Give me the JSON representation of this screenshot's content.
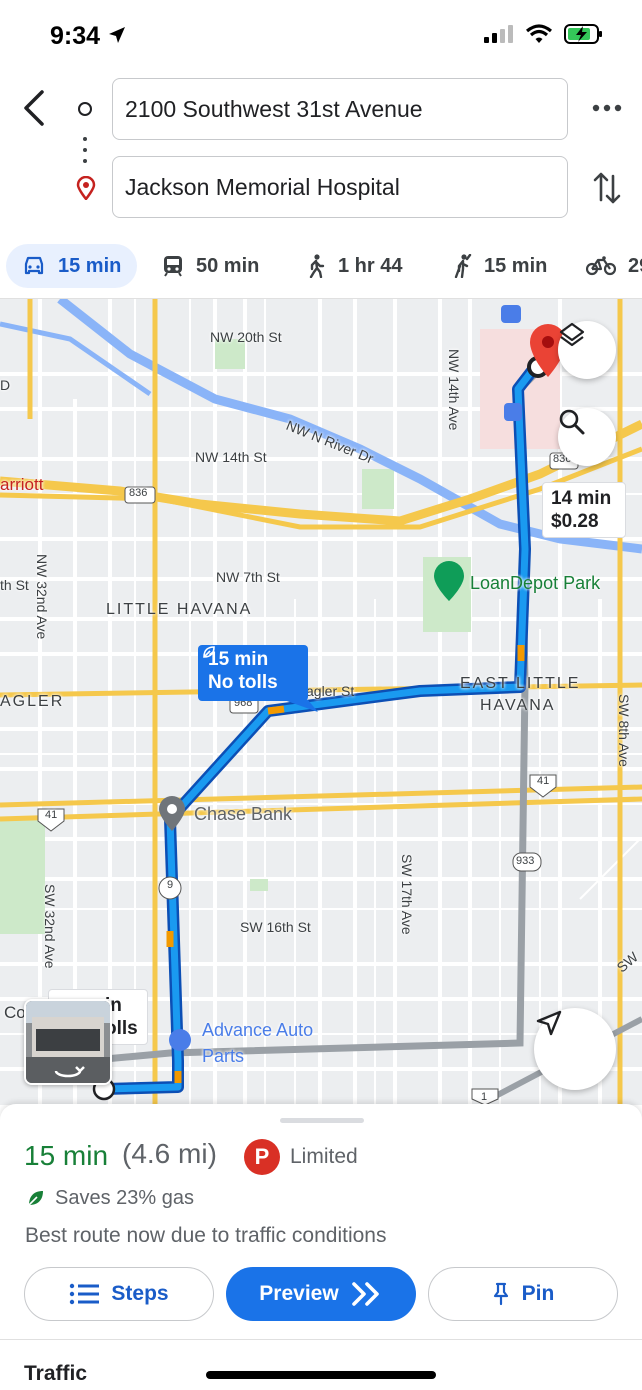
{
  "status_bar": {
    "time": "9:34"
  },
  "directions": {
    "origin": "2100 Southwest 31st Avenue",
    "destination": "Jackson Memorial Hospital"
  },
  "modes": [
    {
      "icon": "car-icon",
      "label": "15 min",
      "active": true
    },
    {
      "icon": "transit-icon",
      "label": "50 min"
    },
    {
      "icon": "walk-icon",
      "label": "1 hr 44"
    },
    {
      "icon": "ride-icon",
      "label": "15 min"
    },
    {
      "icon": "bike-icon",
      "label": "29"
    }
  ],
  "map": {
    "route_callout": {
      "line1": "15 min",
      "line2": "No tolls"
    },
    "alt_callout": {
      "line1": "14 min",
      "line2": "$0.28"
    },
    "alt_partial": {
      "line1": "in",
      "line2": "olls"
    },
    "labels": {
      "nw20": "NW 20th St",
      "nw14": "NW 14th St",
      "river": "NW N River Dr",
      "nw14ave": "NW 14th Ave",
      "marriott": "arriott",
      "r836a": "836",
      "r836b": "836",
      "nw7": "NW 7th St",
      "little_havana": "LITTLE HAVANA",
      "loandepot": "LoanDepot Park",
      "east_little_havana_1": "EAST LITTLE",
      "east_little_havana_2": "HAVANA",
      "flagler_left": "AGLER",
      "flagler_mid": "agler St",
      "r968": "968",
      "r41a": "41",
      "r41b": "41",
      "chase": "Chase Bank",
      "r9": "9",
      "r933": "933",
      "sw16": "SW 16th St",
      "sw17": "SW 17th Ave",
      "sw32": "SW 32nd Ave",
      "nw32": "NW 32nd Ave",
      "sw8": "SW 8th Ave",
      "th_st": "th St",
      "advance_1": "Advance Auto",
      "advance_2": "Parts",
      "co": "Co",
      "sw_right": "SW",
      "r1": "1",
      "p_left": "D"
    }
  },
  "summary": {
    "eta": "15 min",
    "distance": "(4.6 mi)",
    "parking_letter": "P",
    "parking": "Limited",
    "gas": "Saves 23% gas",
    "reason": "Best route now due to traffic conditions"
  },
  "actions": {
    "steps": "Steps",
    "preview": "Preview",
    "pin": "Pin"
  },
  "section": {
    "traffic": "Traffic"
  },
  "colors": {
    "route": "#1a73e8",
    "eta": "#188038",
    "accent": "#1a5cc8",
    "parking": "#d93025"
  }
}
